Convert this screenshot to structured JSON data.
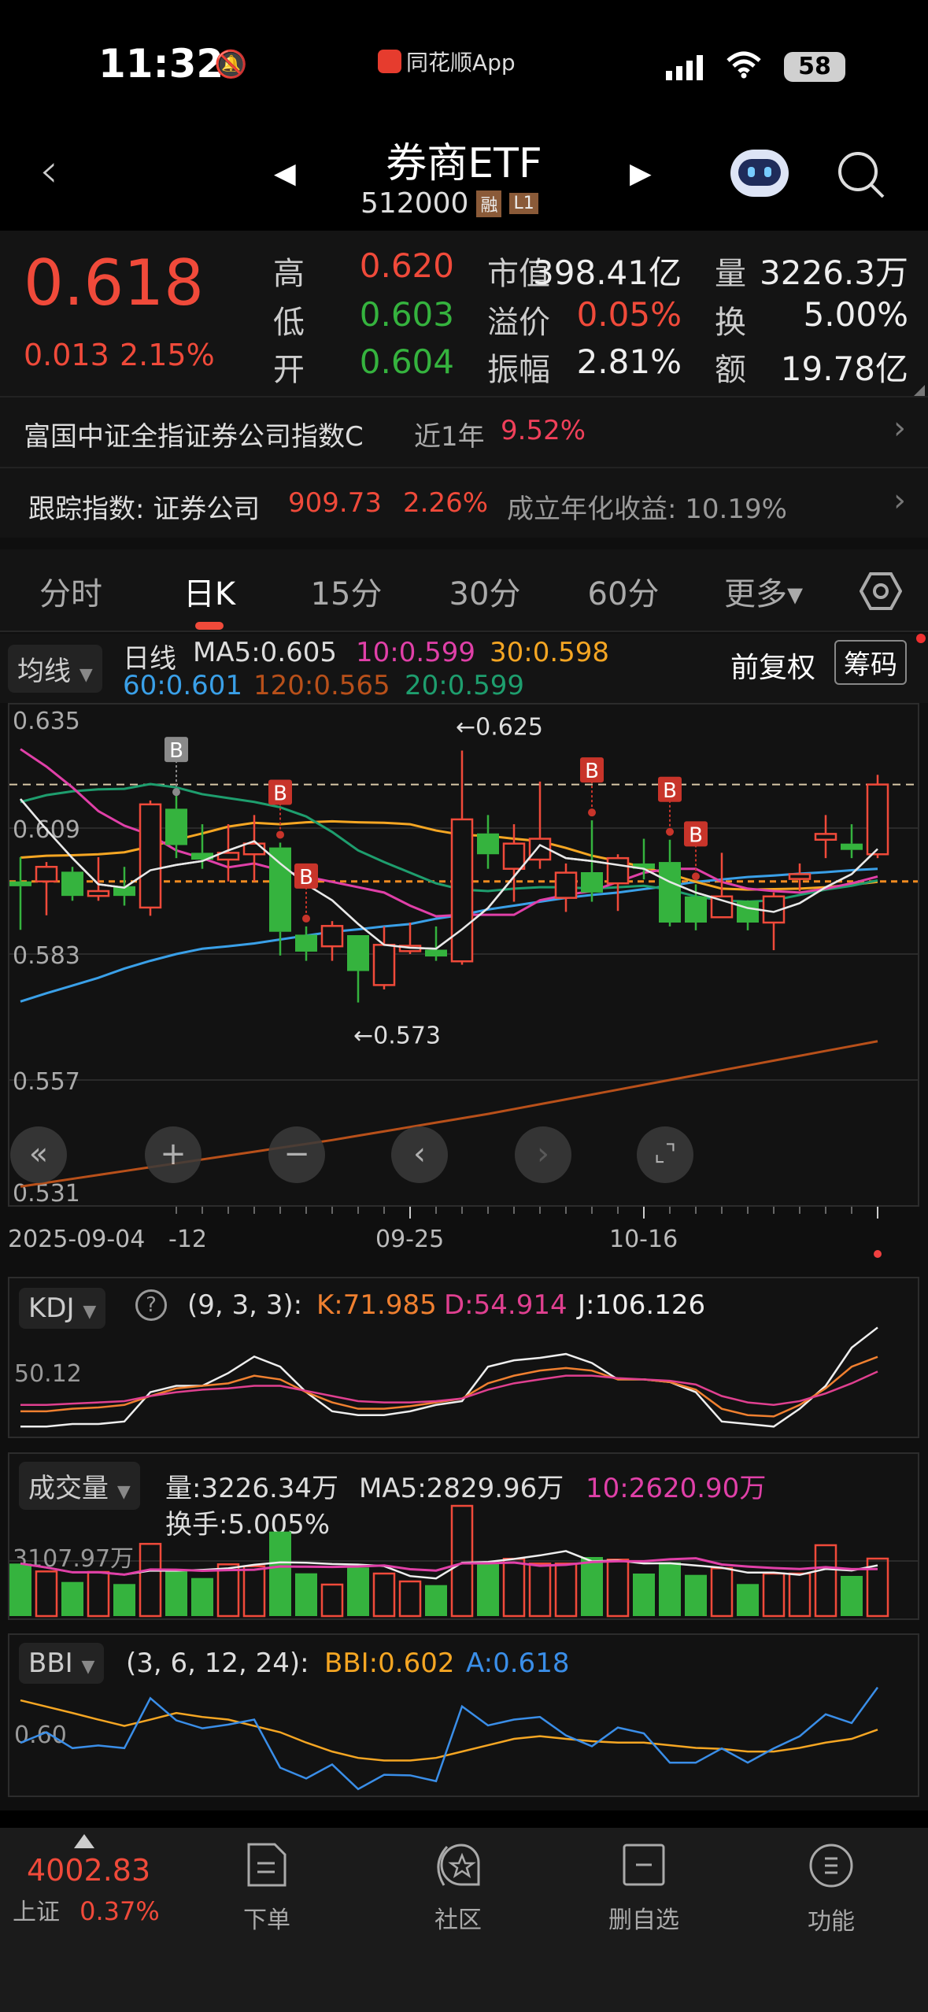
{
  "status": {
    "time": "11:32",
    "app_label": "同花顺App",
    "battery": "58"
  },
  "header": {
    "title": "券商ETF",
    "code": "512000",
    "badge_margin": "融",
    "badge_level": "L1"
  },
  "quote": {
    "price": "0.618",
    "change": "0.013",
    "change_pct": "2.15%",
    "stats": [
      {
        "label": "高",
        "value": "0.620",
        "color": "red"
      },
      {
        "label": "低",
        "value": "0.603",
        "color": "green"
      },
      {
        "label": "开",
        "value": "0.604",
        "color": "green"
      },
      {
        "label": "市值",
        "value": "398.41亿",
        "color": "white"
      },
      {
        "label": "溢价",
        "value": "0.05%",
        "color": "red"
      },
      {
        "label": "振幅",
        "value": "2.81%",
        "color": "white"
      },
      {
        "label": "量",
        "value": "3226.3万",
        "color": "white"
      },
      {
        "label": "换",
        "value": "5.00%",
        "color": "white"
      },
      {
        "label": "额",
        "value": "19.78亿",
        "color": "white"
      }
    ]
  },
  "fund_row": {
    "name": "富国中证全指证券公司指数C",
    "period": "近1年",
    "return": "9.52%"
  },
  "track_row": {
    "label": "跟踪指数: 证券公司",
    "value": "909.73",
    "pct": "2.26%",
    "annual": "成立年化收益: 10.19%"
  },
  "tabs": [
    "分时",
    "日K",
    "15分",
    "30分",
    "60分",
    "更多▾"
  ],
  "ma_legend": {
    "dropdown": "均线",
    "period": "日线",
    "ma5": "MA5:0.605",
    "ma10": "10:0.599",
    "ma30": "30:0.598",
    "ma60": "60:0.601",
    "ma120": "120:0.565",
    "ma20": "20:0.599",
    "adjust": "前复权",
    "chips": "筹码"
  },
  "colors": {
    "up": "#f04a3a",
    "down": "#35b33e",
    "ma5": "#e8e8e8",
    "ma10": "#e040a8",
    "ma20": "#1e9e6e",
    "ma30": "#f5a623",
    "ma60": "#3aa0e8",
    "ma120": "#b8501a"
  },
  "chart_data": {
    "type": "candlestick",
    "y_ticks": [
      "0.635",
      "0.609",
      "0.583",
      "0.557",
      "0.531"
    ],
    "y_tick_values": [
      0.635,
      0.609,
      0.583,
      0.557,
      0.531
    ],
    "ylim": [
      0.531,
      0.635
    ],
    "ref_lines": [
      0.618,
      0.598
    ],
    "max_label": "←0.625",
    "min_label": "←0.573",
    "max_index": 17,
    "min_index": 13,
    "x_labels": [
      {
        "i": 0,
        "text": "2025-09-04"
      },
      {
        "i": 6,
        "text": "-12"
      },
      {
        "i": 15,
        "text": "09-25"
      },
      {
        "i": 24,
        "text": "10-16"
      }
    ],
    "candles": [
      [
        0.598,
        0.603,
        0.588,
        0.597
      ],
      [
        0.598,
        0.602,
        0.591,
        0.601
      ],
      [
        0.6,
        0.601,
        0.594,
        0.595
      ],
      [
        0.595,
        0.603,
        0.594,
        0.596
      ],
      [
        0.597,
        0.601,
        0.593,
        0.595
      ],
      [
        0.5926,
        0.6147,
        0.5909,
        0.6139
      ],
      [
        0.613,
        0.6158,
        0.6028,
        0.6055
      ],
      [
        0.6039,
        0.6098,
        0.6006,
        0.6025
      ],
      [
        0.6025,
        0.6098,
        0.598,
        0.6039
      ],
      [
        0.6036,
        0.6117,
        0.598,
        0.6058
      ],
      [
        0.605,
        0.606,
        0.5827,
        0.5876
      ],
      [
        0.587,
        0.5887,
        0.5816,
        0.5835
      ],
      [
        0.5846,
        0.5898,
        0.5816,
        0.5888
      ],
      [
        0.5869,
        0.5869,
        0.573,
        0.5795
      ],
      [
        0.5766,
        0.5887,
        0.5757,
        0.5849
      ],
      [
        0.5836,
        0.5895,
        0.583,
        0.5847
      ],
      [
        0.5839,
        0.5887,
        0.5816,
        0.5825
      ],
      [
        0.5815,
        0.625,
        0.5808,
        0.6108
      ],
      [
        0.6079,
        0.6117,
        0.6006,
        0.6036
      ],
      [
        0.6006,
        0.6098,
        0.5938,
        0.6058
      ],
      [
        0.6025,
        0.6186,
        0.6006,
        0.6068
      ],
      [
        0.5946,
        0.6017,
        0.5917,
        0.5998
      ],
      [
        0.5999,
        0.6106,
        0.5938,
        0.5957
      ],
      [
        0.5976,
        0.6036,
        0.5919,
        0.6028
      ],
      [
        0.6017,
        0.6068,
        0.5984,
        0.6006
      ],
      [
        0.602,
        0.6066,
        0.5887,
        0.5895
      ],
      [
        0.5949,
        0.5974,
        0.5879,
        0.5895
      ],
      [
        0.5906,
        0.6039,
        0.5906,
        0.5949
      ],
      [
        0.594,
        0.5941,
        0.5879,
        0.5895
      ],
      [
        0.5895,
        0.5957,
        0.5838,
        0.5949
      ],
      [
        0.5985,
        0.6017,
        0.596,
        0.5995
      ],
      [
        0.6066,
        0.6117,
        0.6028,
        0.6078
      ],
      [
        0.6058,
        0.6098,
        0.6028,
        0.6045
      ],
      [
        0.6036,
        0.62,
        0.6028,
        0.618
      ]
    ],
    "ma": {
      "ma5": [
        0.615,
        0.6087,
        0.6028,
        0.5974,
        0.5967,
        0.6003,
        0.6014,
        0.6022,
        0.6044,
        0.6063,
        0.6017,
        0.5974,
        0.5941,
        0.5892,
        0.5849,
        0.5843,
        0.5841,
        0.5881,
        0.5925,
        0.599,
        0.6055,
        0.6028,
        0.6022,
        0.6014,
        0.6006,
        0.5979,
        0.5957,
        0.5941,
        0.5925,
        0.5917,
        0.5935,
        0.5968,
        0.5995,
        0.6047
      ],
      "ma10": [
        0.6253,
        0.6217,
        0.6174,
        0.6125,
        0.6095,
        0.6076,
        0.6044,
        0.6028,
        0.6009,
        0.6017,
        0.6003,
        0.599,
        0.5979,
        0.5968,
        0.5957,
        0.593,
        0.5908,
        0.5911,
        0.5911,
        0.5911,
        0.5941,
        0.5952,
        0.596,
        0.5979,
        0.5998,
        0.6006,
        0.6006,
        0.5979,
        0.5965,
        0.596,
        0.5957,
        0.5965,
        0.5976,
        0.599
      ],
      "ma20": [
        0.6144,
        0.6158,
        0.6166,
        0.617,
        0.6171,
        0.6181,
        0.6174,
        0.616,
        0.6152,
        0.6144,
        0.6133,
        0.6114,
        0.6082,
        0.6044,
        0.602,
        0.5998,
        0.5976,
        0.5963,
        0.596,
        0.5965,
        0.5968,
        0.5968,
        0.5965,
        0.5968,
        0.5971,
        0.5963,
        0.5949,
        0.5941,
        0.5938,
        0.5941,
        0.5952,
        0.5963,
        0.5971,
        0.5982
      ],
      "ma30": [
        0.6029,
        0.6033,
        0.6034,
        0.6036,
        0.604,
        0.6052,
        0.6066,
        0.6079,
        0.6093,
        0.6101,
        0.6098,
        0.6102,
        0.6104,
        0.6102,
        0.6101,
        0.6098,
        0.6085,
        0.6076,
        0.6074,
        0.6068,
        0.6063,
        0.6049,
        0.6033,
        0.6022,
        0.6009,
        0.5995,
        0.5979,
        0.5965,
        0.5963,
        0.5964,
        0.5965,
        0.5968,
        0.5973,
        0.5979
      ],
      "ma60": [
        0.5732,
        0.5749,
        0.5765,
        0.5781,
        0.58,
        0.5816,
        0.583,
        0.5841,
        0.5846,
        0.5852,
        0.586,
        0.5868,
        0.5876,
        0.5881,
        0.5887,
        0.5892,
        0.5903,
        0.5911,
        0.5922,
        0.593,
        0.5938,
        0.5946,
        0.5952,
        0.5957,
        0.5964,
        0.5971,
        0.5979,
        0.5984,
        0.5989,
        0.5992,
        0.5996,
        0.5999,
        0.6003,
        0.6006
      ],
      "ma120": [
        0.535,
        0.5358,
        0.5366,
        0.5374,
        0.5382,
        0.539,
        0.5398,
        0.5406,
        0.5414,
        0.5422,
        0.543,
        0.5438,
        0.5446,
        0.5455,
        0.5464,
        0.5473,
        0.5482,
        0.5491,
        0.55,
        0.551,
        0.552,
        0.553,
        0.554,
        0.555,
        0.556,
        0.557,
        0.558,
        0.559,
        0.56,
        0.561,
        0.562,
        0.563,
        0.564,
        0.565
      ]
    },
    "signals": [
      {
        "i": 6,
        "label": "B",
        "style": "gray"
      },
      {
        "i": 10,
        "label": "B",
        "style": "red"
      },
      {
        "i": 11,
        "label": "B",
        "style": "red"
      },
      {
        "i": 22,
        "label": "B",
        "style": "red"
      },
      {
        "i": 25,
        "label": "B",
        "style": "red"
      },
      {
        "i": 26,
        "label": "B",
        "style": "red"
      }
    ],
    "kdj": {
      "K": [
        8.7,
        8.7,
        11.6,
        13.1,
        16.1,
        26.4,
        35.3,
        38.3,
        41.2,
        50.1,
        45.7,
        30.9,
        19.0,
        11.6,
        11.6,
        14.6,
        19.0,
        23.5,
        41.2,
        50.1,
        56.0,
        59.0,
        56.0,
        45.7,
        45.7,
        42.7,
        33.8,
        11.6,
        4.2,
        2.7,
        16.1,
        35.3,
        60.5,
        72.0
      ],
      "D": [
        16.1,
        16.1,
        17.6,
        19.0,
        20.5,
        26.4,
        30.9,
        33.8,
        35.3,
        38.3,
        38.3,
        32.4,
        26.4,
        20.5,
        19.0,
        19.0,
        20.5,
        23.5,
        33.8,
        41.2,
        45.7,
        50.1,
        50.1,
        47.2,
        45.7,
        44.2,
        39.8,
        26.4,
        19.0,
        16.1,
        20.5,
        29.4,
        41.2,
        54.9
      ],
      "J": [
        -9.1,
        -9.1,
        -6.1,
        -6.1,
        -3.2,
        30.9,
        38.3,
        38.3,
        53.1,
        72.3,
        60.5,
        30.9,
        8.7,
        4.2,
        4.2,
        8.7,
        16.1,
        20.5,
        60.5,
        67.9,
        70.8,
        75.3,
        64.9,
        45.7,
        45.7,
        42.7,
        30.9,
        -3.2,
        -6.1,
        -9.1,
        11.6,
        38.3,
        82.7,
        106.1
      ],
      "ylim": [
        -18,
        112
      ]
    },
    "volume_wan": [
      2948,
      2506,
      1914,
      2475,
      1799,
      4053,
      2506,
      2135,
      2904,
      2798,
      4743,
      2400,
      1768,
      2727,
      2387,
      1945,
      1737,
      6188,
      2948,
      3213,
      2948,
      2948,
      3315,
      3169,
      2387,
      3019,
      2312,
      2683,
      1799,
      2387,
      2387,
      3978,
      2254,
      3226
    ],
    "bbi": [
      0.6131,
      0.6107,
      0.6083,
      0.6058,
      0.6034,
      0.6058,
      0.6083,
      0.6068,
      0.6058,
      0.6034,
      0.601,
      0.5971,
      0.5937,
      0.5913,
      0.5903,
      0.5903,
      0.5913,
      0.5937,
      0.5961,
      0.5985,
      0.5995,
      0.5985,
      0.5976,
      0.5971,
      0.5971,
      0.5961,
      0.5951,
      0.5947,
      0.5937,
      0.5937,
      0.5951,
      0.5971,
      0.5985,
      0.602
    ]
  },
  "kdj_panel": {
    "dropdown": "KDJ",
    "params": "(9, 3, 3):",
    "k": "K:71.985",
    "d": "D:54.914",
    "j": "J:106.126",
    "ref_label": "50.12"
  },
  "vol_panel": {
    "dropdown": "成交量",
    "vol": "量:3226.34万",
    "ma5": "MA5:2829.96万",
    "ma10": "10:2620.90万",
    "turnover": "换手:5.005%",
    "ref_label": "3107.97万"
  },
  "bbi_panel": {
    "dropdown": "BBI",
    "params": "(3, 6, 12, 24):",
    "bbi": "BBI:0.602",
    "a": "A:0.618",
    "ref_label": "0.60"
  },
  "bottom_nav": {
    "index_value": "4002.83",
    "index_name": "上证",
    "index_pct": "0.37%",
    "items": [
      "下单",
      "社区",
      "删自选",
      "功能"
    ]
  }
}
